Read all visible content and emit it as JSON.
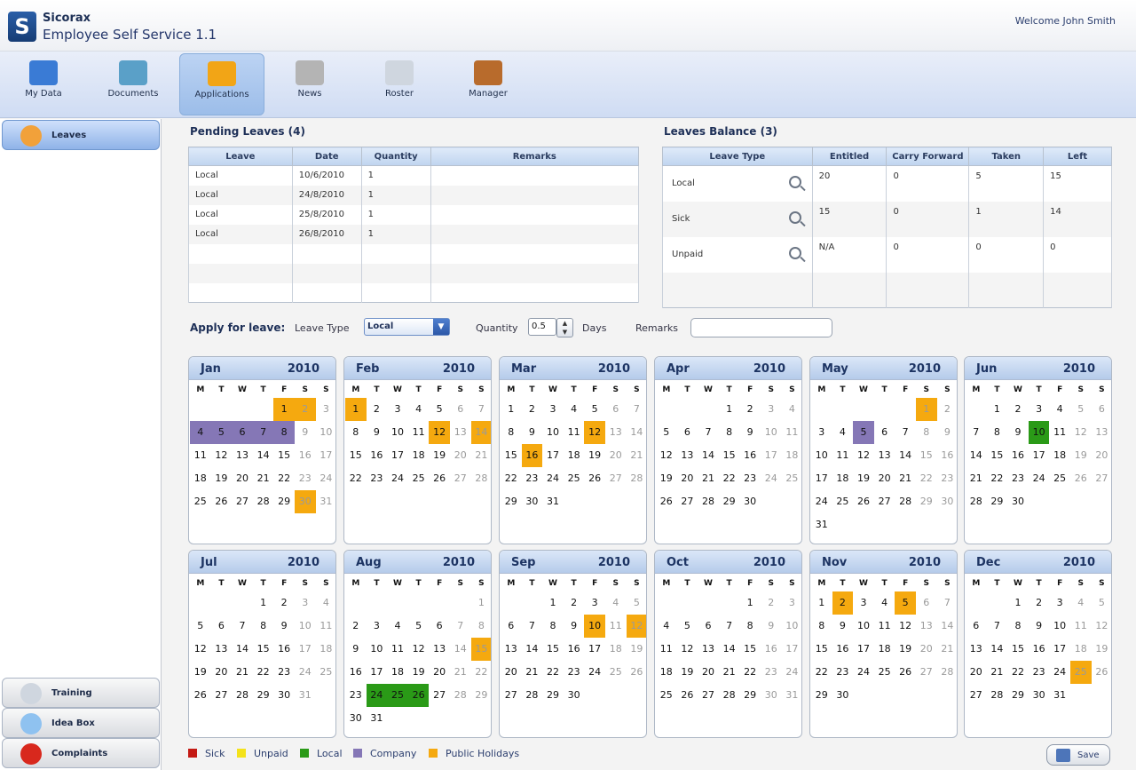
{
  "app": {
    "brand": "Sicorax",
    "product": "Employee Self Service 1.1",
    "welcome": "Welcome John Smith",
    "logo_letter": "S"
  },
  "nav": [
    {
      "label": "My Data",
      "icon": "my-data-icon",
      "color": "#3a7bd5"
    },
    {
      "label": "Documents",
      "icon": "documents-icon",
      "color": "#5aa0c8"
    },
    {
      "label": "Applications",
      "icon": "applications-icon",
      "color": "#f2a516",
      "active": true
    },
    {
      "label": "News",
      "icon": "news-icon",
      "color": "#b4b4b4"
    },
    {
      "label": "Roster",
      "icon": "roster-icon",
      "color": "#cfd6df"
    },
    {
      "label": "Manager",
      "icon": "manager-icon",
      "color": "#b86b2c"
    }
  ],
  "sidebar": {
    "top": {
      "label": "Leaves",
      "icon": "leaves-icon",
      "color": "#f1a13a"
    },
    "bottom": [
      {
        "label": "Training",
        "icon": "training-icon",
        "color": "#cfd6df"
      },
      {
        "label": "Idea Box",
        "icon": "idea-box-icon",
        "color": "#8fc2f0"
      },
      {
        "label": "Complaints",
        "icon": "complaints-icon",
        "color": "#d8281d"
      }
    ]
  },
  "pending": {
    "title": "Pending Leaves (4)",
    "columns": [
      "Leave",
      "Date",
      "Quantity",
      "Remarks"
    ],
    "rows": [
      [
        "Local",
        "10/6/2010",
        "1",
        ""
      ],
      [
        "Local",
        "24/8/2010",
        "1",
        ""
      ],
      [
        "Local",
        "25/8/2010",
        "1",
        ""
      ],
      [
        "Local",
        "26/8/2010",
        "1",
        ""
      ]
    ]
  },
  "balance": {
    "title": "Leaves Balance (3)",
    "columns": [
      "Leave Type",
      "Entitled",
      "Carry Forward",
      "Taken",
      "Left"
    ],
    "rows": [
      [
        "Local",
        "20",
        "0",
        "5",
        "15"
      ],
      [
        "Sick",
        "15",
        "0",
        "1",
        "14"
      ],
      [
        "Unpaid",
        "N/A",
        "0",
        "0",
        "0"
      ]
    ]
  },
  "apply": {
    "title": "Apply for leave:",
    "leave_type_label": "Leave Type",
    "leave_type_value": "Local",
    "quantity_label": "Quantity",
    "quantity_value": "0.5",
    "days_label": "Days",
    "remarks_label": "Remarks",
    "remarks_value": ""
  },
  "calendar": {
    "weekday_headers": [
      "M",
      "T",
      "W",
      "T",
      "F",
      "S",
      "S"
    ],
    "months": [
      {
        "name": "Jan",
        "year": "2010",
        "offset": 4,
        "days": 31,
        "marks": {
          "1": "ph",
          "2": "ph",
          "4": "co",
          "5": "co",
          "6": "co",
          "7": "co",
          "8": "co",
          "30": "ph"
        }
      },
      {
        "name": "Feb",
        "year": "2010",
        "offset": 0,
        "days": 28,
        "marks": {
          "1": "ph",
          "12": "ph",
          "14": "ph"
        }
      },
      {
        "name": "Mar",
        "year": "2010",
        "offset": 0,
        "days": 31,
        "marks": {
          "12": "ph",
          "16": "ph"
        }
      },
      {
        "name": "Apr",
        "year": "2010",
        "offset": 3,
        "days": 30,
        "marks": {}
      },
      {
        "name": "May",
        "year": "2010",
        "offset": 5,
        "days": 31,
        "marks": {
          "1": "ph",
          "5": "co"
        }
      },
      {
        "name": "Jun",
        "year": "2010",
        "offset": 1,
        "days": 30,
        "marks": {
          "10": "lo"
        }
      },
      {
        "name": "Jul",
        "year": "2010",
        "offset": 3,
        "days": 31,
        "marks": {}
      },
      {
        "name": "Aug",
        "year": "2010",
        "offset": 6,
        "days": 31,
        "marks": {
          "15": "ph",
          "24": "lo",
          "25": "lo",
          "26": "lo"
        }
      },
      {
        "name": "Sep",
        "year": "2010",
        "offset": 2,
        "days": 30,
        "marks": {
          "10": "ph",
          "12": "ph"
        }
      },
      {
        "name": "Oct",
        "year": "2010",
        "offset": 4,
        "days": 31,
        "marks": {}
      },
      {
        "name": "Nov",
        "year": "2010",
        "offset": 0,
        "days": 30,
        "marks": {
          "2": "ph",
          "5": "ph"
        }
      },
      {
        "name": "Dec",
        "year": "2010",
        "offset": 2,
        "days": 31,
        "marks": {
          "25": "ph"
        }
      }
    ]
  },
  "legend": [
    {
      "label": "Sick",
      "color": "#c41a14"
    },
    {
      "label": "Unpaid",
      "color": "#f4e21b"
    },
    {
      "label": "Local",
      "color": "#2a9a17"
    },
    {
      "label": "Company",
      "color": "#8577b6"
    },
    {
      "label": "Public Holidays",
      "color": "#f5a90f"
    }
  ],
  "save_label": "Save"
}
